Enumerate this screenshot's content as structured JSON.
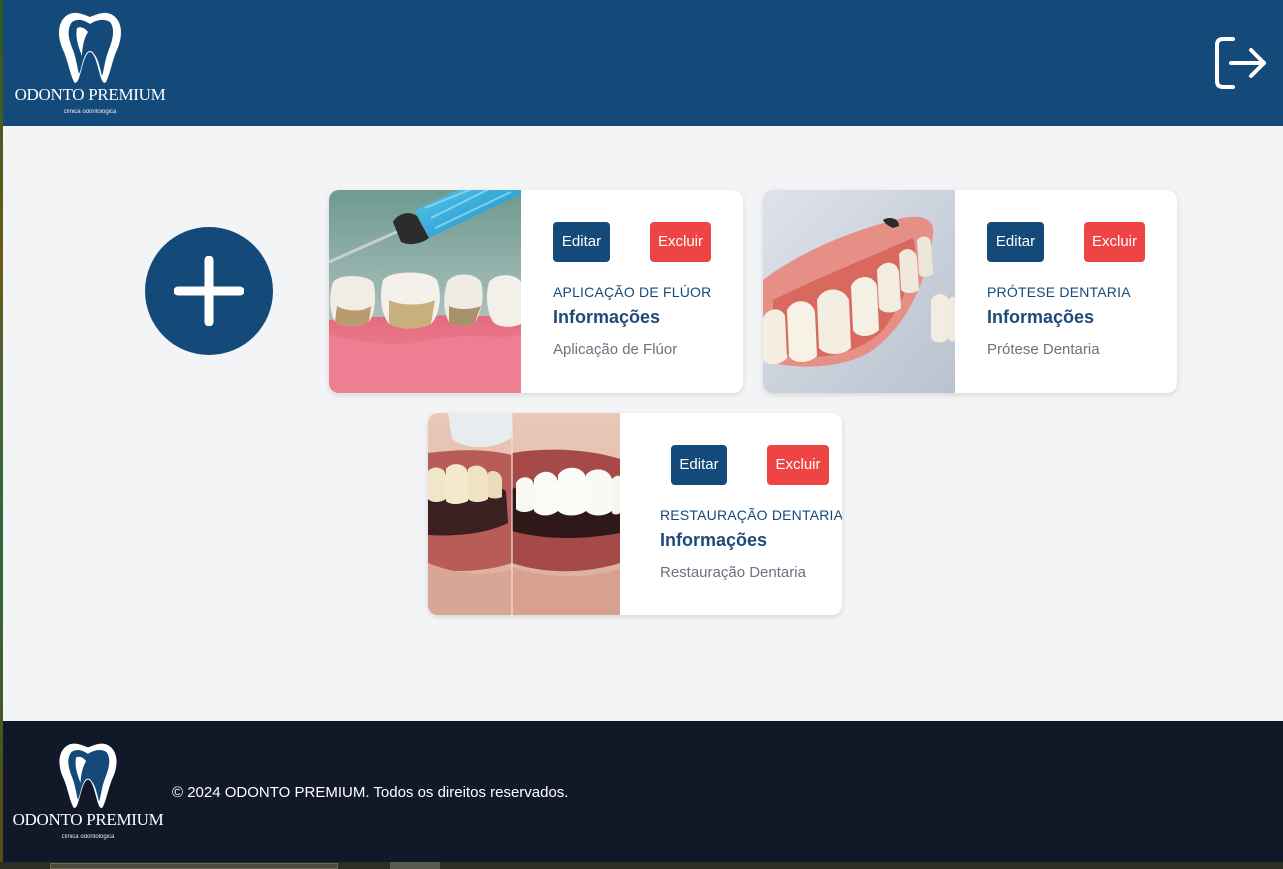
{
  "brand": {
    "name": "ODONTO PREMIUM",
    "tagline": "clínica odontológica"
  },
  "colors": {
    "primary": "#134a7a",
    "danger": "#ef4444",
    "page_bg": "#f3f4f6",
    "footer_bg": "#111827"
  },
  "header": {
    "logout_icon": "logout-icon"
  },
  "add_button": {
    "icon": "plus-icon"
  },
  "cards": [
    {
      "title": "APLICAÇÃO DE FLÚOR",
      "subtitle": "Informações",
      "description": "Aplicação de Flúor",
      "edit_label": "Editar",
      "delete_label": "Excluir"
    },
    {
      "title": "PRÓTESE DENTARIA",
      "subtitle": "Informações",
      "description": "Prótese Dentaria",
      "edit_label": "Editar",
      "delete_label": "Excluir"
    },
    {
      "title": "RESTAURAÇÃO DENTARIA",
      "subtitle": "Informações",
      "description": "Restauração Dentaria",
      "edit_label": "Editar",
      "delete_label": "Excluir"
    }
  ],
  "footer": {
    "copyright": "© 2024 ODONTO PREMIUM. Todos os direitos reservados."
  }
}
